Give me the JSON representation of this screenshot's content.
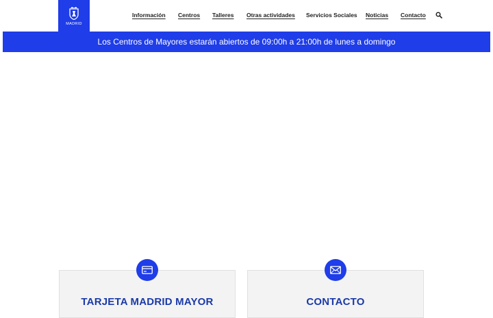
{
  "logo": {
    "text": "MADRID"
  },
  "nav": {
    "items": [
      {
        "label": "Información"
      },
      {
        "label": "Centros"
      },
      {
        "label": "Talleres"
      },
      {
        "label": "Otras actividades"
      },
      {
        "label": "Servicios Sociales"
      },
      {
        "label": "Noticias"
      },
      {
        "label": "Contacto"
      }
    ]
  },
  "banner": {
    "text": "Los Centros de Mayores estarán abiertos de 09:00h a 21:00h de lunes a domingo"
  },
  "cards": [
    {
      "title": "TARJETA MADRID MAYOR",
      "icon": "credit-card-icon"
    },
    {
      "title": "CONTACTO",
      "icon": "envelope-icon"
    }
  ],
  "colors": {
    "brand": "#1f3de8",
    "card_title": "#1a3aa8",
    "card_bg": "#f3f3f3"
  }
}
